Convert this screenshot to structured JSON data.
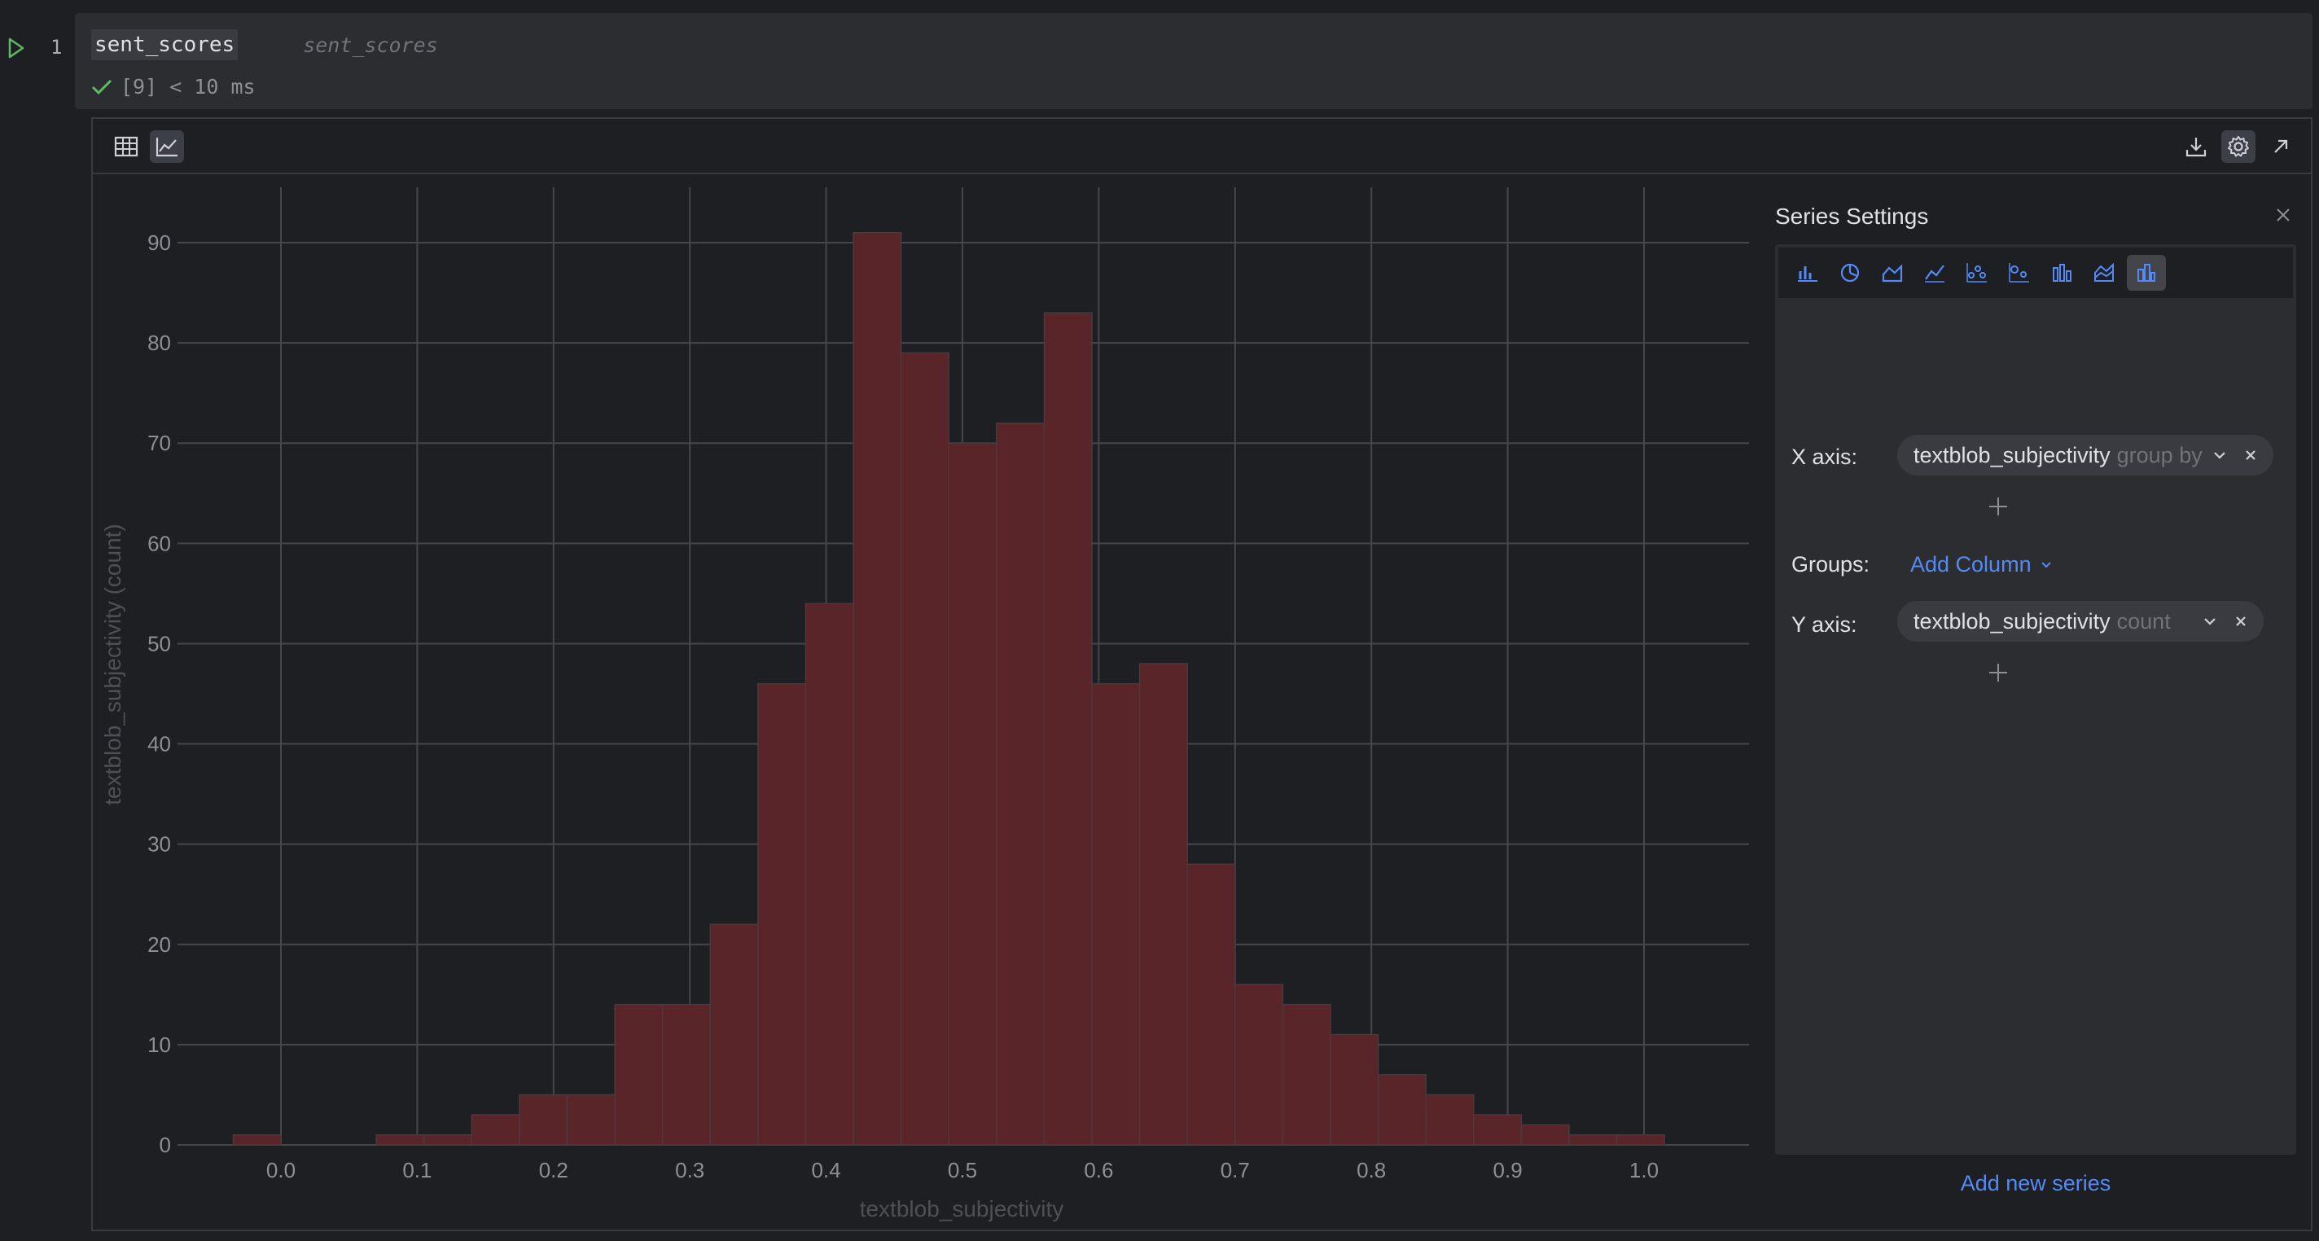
{
  "cell": {
    "line_number": "1",
    "code": "sent_scores",
    "inline_hint": "sent_scores",
    "exec_status": "[9] < 10 ms"
  },
  "icons": {
    "run": "run-triangle-icon",
    "check": "check-icon",
    "table_view": "table-icon",
    "chart_view": "chart-icon",
    "download": "download-icon",
    "settings": "gear-icon",
    "open": "open-external-icon"
  },
  "settings": {
    "title": "Series Settings",
    "chart_types": [
      "bar",
      "pie",
      "area",
      "line",
      "scatter",
      "bubble",
      "stacked-bar",
      "stacked-area",
      "histogram"
    ],
    "active_chart_type": "histogram",
    "x_axis_label": "X axis:",
    "x_axis_column": "textblob_subjectivity",
    "x_axis_agg": "group by",
    "groups_label": "Groups:",
    "add_column": "Add Column",
    "y_axis_label": "Y axis:",
    "y_axis_column": "textblob_subjectivity",
    "y_axis_agg": "count",
    "add_series": "Add new series"
  },
  "colors": {
    "bar_fill": "#5a2529",
    "bar_stroke": "#4a3a3c",
    "accent": "#548af7",
    "success": "#5fb865"
  },
  "chart_data": {
    "type": "bar",
    "xlabel": "textblob_subjectivity",
    "ylabel": "textblob_subjectivity (count)",
    "xlim": [
      -0.075,
      1.075
    ],
    "ylim": [
      0,
      90
    ],
    "xticks": [
      0.0,
      0.1,
      0.2,
      0.3,
      0.4,
      0.5,
      0.6,
      0.7,
      0.8,
      0.9,
      1.0
    ],
    "xtick_labels": [
      "0.0",
      "0.1",
      "0.2",
      "0.3",
      "0.4",
      "0.5",
      "0.6",
      "0.7",
      "0.8",
      "0.9",
      "1.0"
    ],
    "yticks": [
      0,
      10,
      20,
      30,
      40,
      50,
      60,
      70,
      80,
      90
    ],
    "ytick_labels": [
      "0",
      "10",
      "20",
      "30",
      "40",
      "50",
      "60",
      "70",
      "80",
      "90"
    ],
    "grid": true,
    "bin_width": 0.035,
    "x": [
      -0.0175,
      0.0175,
      0.0525,
      0.0875,
      0.1225,
      0.1575,
      0.1925,
      0.2275,
      0.2625,
      0.2975,
      0.3325,
      0.3675,
      0.4025,
      0.4375,
      0.4725,
      0.5075,
      0.5425,
      0.5775,
      0.6125,
      0.6475,
      0.6825,
      0.7175,
      0.7525,
      0.7875,
      0.8225,
      0.8575,
      0.8925,
      0.9275,
      0.9625,
      0.9975
    ],
    "values": [
      1,
      0,
      0,
      1,
      1,
      3,
      5,
      5,
      14,
      14,
      22,
      46,
      54,
      91,
      79,
      70,
      72,
      83,
      46,
      48,
      28,
      16,
      14,
      11,
      7,
      5,
      3,
      2,
      1,
      1
    ]
  }
}
